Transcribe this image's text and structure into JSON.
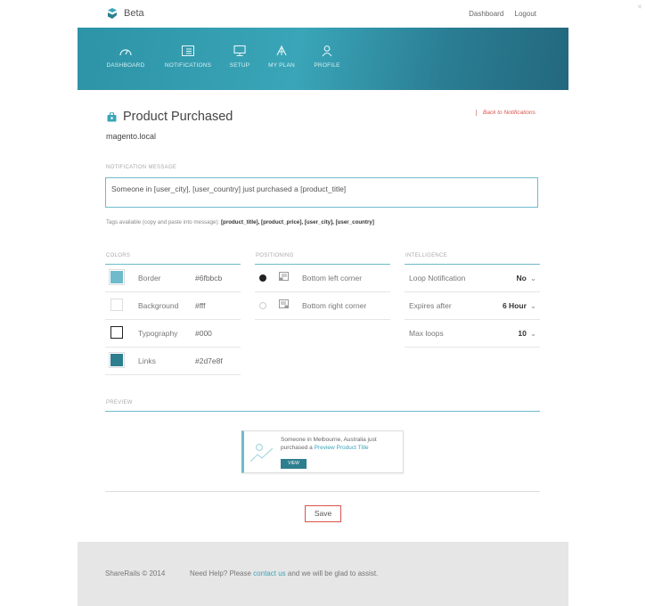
{
  "brand": {
    "name": "Beta"
  },
  "top_links": {
    "dashboard": "Dashboard",
    "logout": "Logout"
  },
  "nav": [
    {
      "label": "DASHBOARD",
      "icon": "gauge-icon"
    },
    {
      "label": "NOTIFICATIONS",
      "icon": "list-icon"
    },
    {
      "label": "SETUP",
      "icon": "monitor-icon"
    },
    {
      "label": "MY PLAN",
      "icon": "plan-icon"
    },
    {
      "label": "PROFILE",
      "icon": "user-icon"
    }
  ],
  "page": {
    "title": "Product Purchased",
    "back_link": "Back to Notifications",
    "domain": "magento.local"
  },
  "message": {
    "label": "NOTIFICATION MESSAGE",
    "value": "Someone in [user_city], [user_country] just purchased a [product_title]",
    "tags_prefix": "Tags available (copy and paste into message):",
    "tags": "[product_title], [product_price], [user_city], [user_country]"
  },
  "colors": {
    "label": "COLORS",
    "items": [
      {
        "name": "Border",
        "value": "#6fbbcb"
      },
      {
        "name": "Background",
        "value": "#fff"
      },
      {
        "name": "Typography",
        "value": "#000"
      },
      {
        "name": "Links",
        "value": "#2d7e8f"
      }
    ]
  },
  "positioning": {
    "label": "POSITIONING",
    "items": [
      {
        "name": "Bottom left corner",
        "selected": true
      },
      {
        "name": "Bottom right corner",
        "selected": false
      }
    ]
  },
  "intelligence": {
    "label": "INTELLIGENCE",
    "items": [
      {
        "name": "Loop Notification",
        "value": "No"
      },
      {
        "name": "Expires after",
        "value": "6 Hour"
      },
      {
        "name": "Max loops",
        "value": "10"
      }
    ]
  },
  "preview": {
    "label": "PREVIEW",
    "text": "Someone in Melbourne, Australia just purchased a",
    "link": "Preview Product Title",
    "button": "VIEW"
  },
  "save_label": "Save",
  "footer": {
    "copyright": "ShareRails © 2014",
    "help_prefix": "Need Help? Please",
    "help_link": "contact us",
    "help_suffix": "and we will be glad to assist."
  },
  "accent_color": "#6fbbcb",
  "header_color": "#2d93a6",
  "alert_color": "#d9534f"
}
